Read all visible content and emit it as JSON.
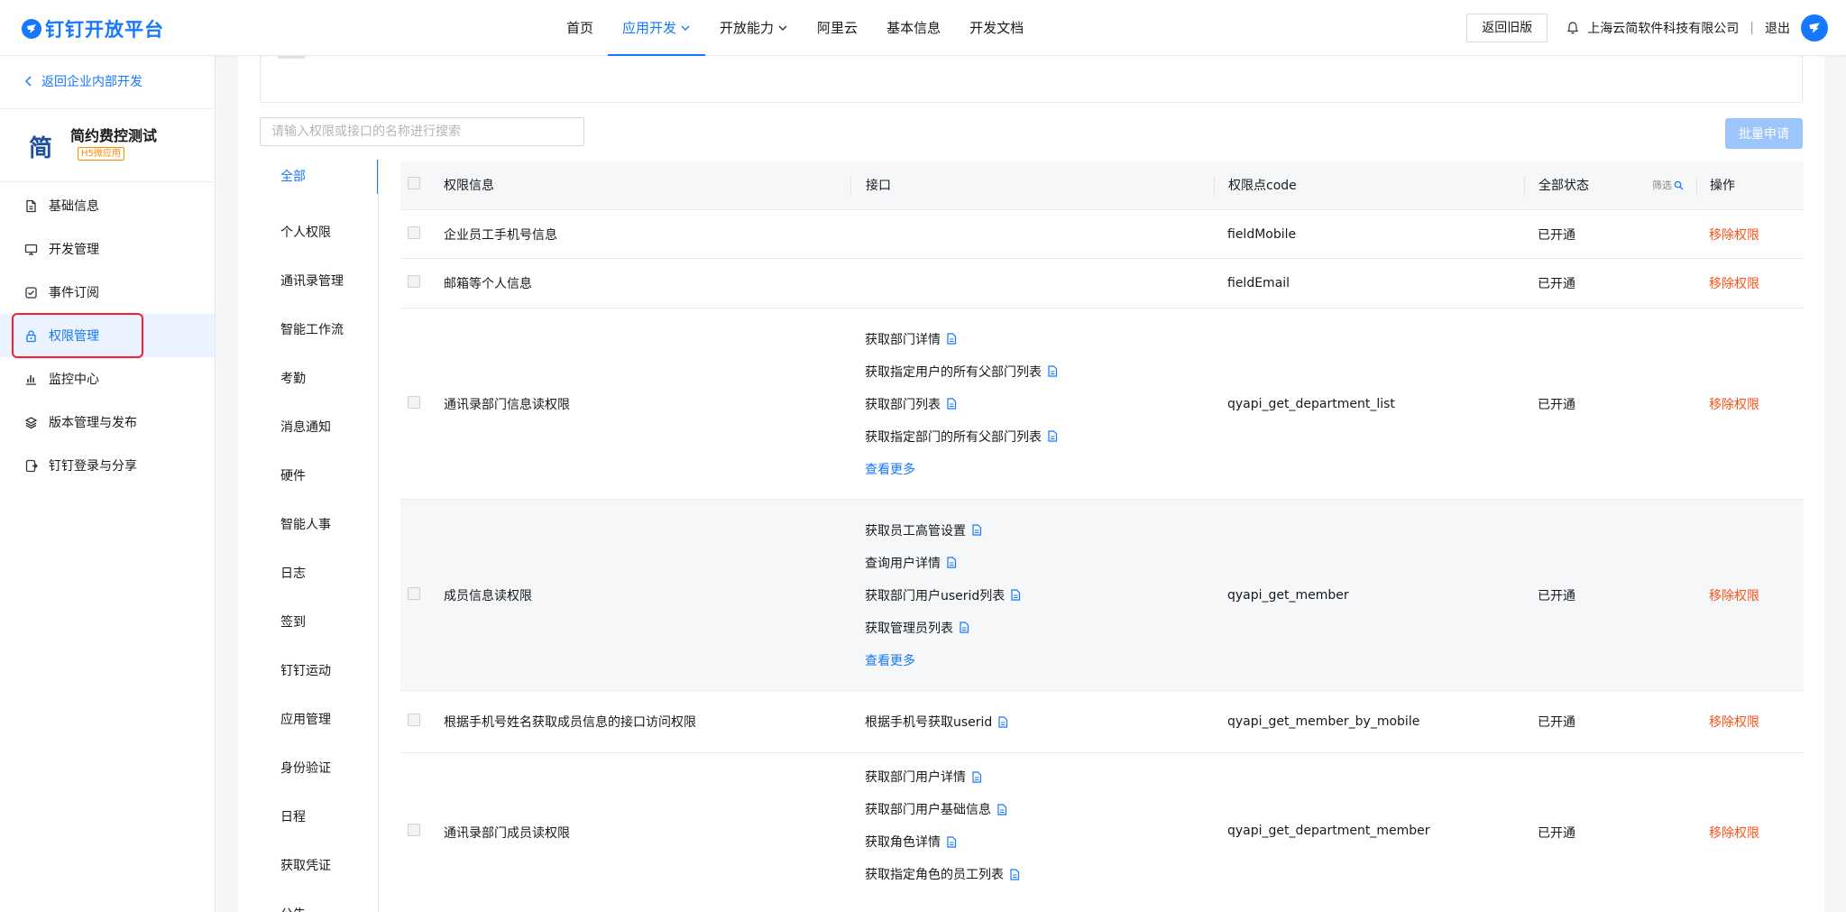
{
  "brand": {
    "name": "钉钉开放平台"
  },
  "nav": {
    "items": [
      {
        "label": "首页",
        "active": false,
        "caret": false
      },
      {
        "label": "应用开发",
        "active": true,
        "caret": true
      },
      {
        "label": "开放能力",
        "active": false,
        "caret": true
      },
      {
        "label": "阿里云",
        "active": false,
        "caret": false
      },
      {
        "label": "基本信息",
        "active": false,
        "caret": false
      },
      {
        "label": "开发文档",
        "active": false,
        "caret": false
      }
    ],
    "old_version_label": "返回旧版",
    "company": "上海云简软件科技有限公司",
    "separator": "|",
    "logout": "退出"
  },
  "sidebar": {
    "back_label": "返回企业内部开发",
    "app_logo_char": "简",
    "app_name": "简约费控测试",
    "app_tag": "H5微应用",
    "items": [
      {
        "label": "基础信息",
        "icon": "document-icon"
      },
      {
        "label": "开发管理",
        "icon": "monitor-icon"
      },
      {
        "label": "事件订阅",
        "icon": "subscribe-icon"
      },
      {
        "label": "权限管理",
        "icon": "lock-icon",
        "active": true
      },
      {
        "label": "监控中心",
        "icon": "bar-chart-icon"
      },
      {
        "label": "版本管理与发布",
        "icon": "layers-icon"
      },
      {
        "label": "钉钉登录与分享",
        "icon": "share-icon"
      }
    ]
  },
  "search": {
    "placeholder": "请输入权限或接口的名称进行搜索"
  },
  "batch_label": "批量申请",
  "categories": [
    "全部",
    "个人权限",
    "通讯录管理",
    "智能工作流",
    "考勤",
    "消息通知",
    "硬件",
    "智能人事",
    "日志",
    "签到",
    "钉钉运动",
    "应用管理",
    "身份验证",
    "日程",
    "获取凭证",
    "公告"
  ],
  "table": {
    "headers": {
      "info": "权限信息",
      "api": "接口",
      "code": "权限点code",
      "status": "全部状态",
      "filter": "筛选",
      "op": "操作"
    },
    "rows": [
      {
        "info": "企业员工手机号信息",
        "apis": [],
        "more": "",
        "code": "fieldMobile",
        "status": "已开通",
        "op": "移除权限"
      },
      {
        "info": "邮箱等个人信息",
        "apis": [],
        "more": "",
        "code": "fieldEmail",
        "status": "已开通",
        "op": "移除权限"
      },
      {
        "info": "通讯录部门信息读权限",
        "apis": [
          "获取部门详情",
          "获取指定用户的所有父部门列表",
          "获取部门列表",
          "获取指定部门的所有父部门列表"
        ],
        "more": "查看更多",
        "code": "qyapi_get_department_list",
        "status": "已开通",
        "op": "移除权限"
      },
      {
        "info": "成员信息读权限",
        "apis": [
          "获取员工高管设置",
          "查询用户详情",
          "获取部门用户userid列表",
          "获取管理员列表"
        ],
        "more": "查看更多",
        "code": "qyapi_get_member",
        "status": "已开通",
        "op": "移除权限",
        "alt": true
      },
      {
        "info": "根据手机号姓名获取成员信息的接口访问权限",
        "apis": [
          "根据手机号获取userid"
        ],
        "more": "",
        "code": "qyapi_get_member_by_mobile",
        "status": "已开通",
        "op": "移除权限"
      },
      {
        "info": "通讯录部门成员读权限",
        "apis": [
          "获取部门用户详情",
          "获取部门用户基础信息",
          "获取角色详情",
          "获取指定角色的员工列表"
        ],
        "more": "",
        "code": "qyapi_get_department_member",
        "status": "已开通",
        "op": "移除权限"
      }
    ]
  },
  "colors": {
    "accent": "#1677ff",
    "danger": "#ff5219",
    "highlight_box": "#f5222d"
  }
}
